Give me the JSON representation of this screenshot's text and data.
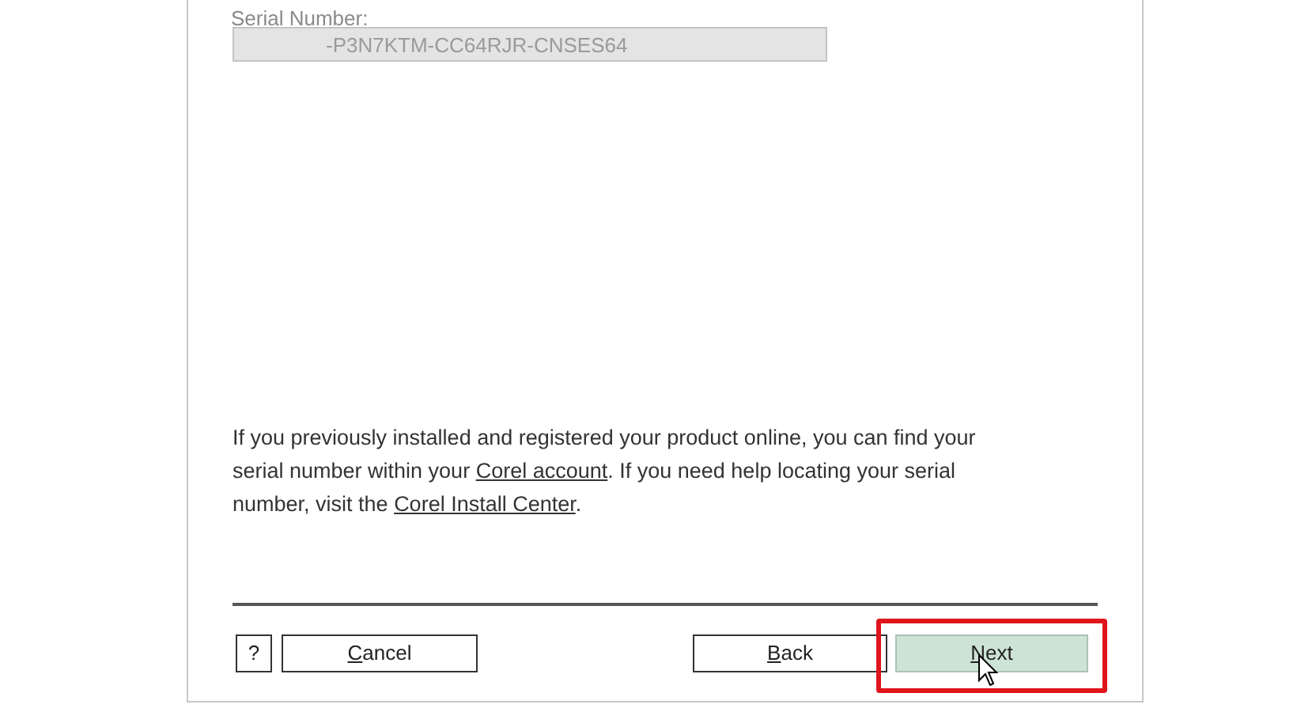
{
  "serial": {
    "label": "Serial Number:",
    "value": "-P3N7KTM-CC64RJR-CNSES64"
  },
  "help_text": [
    {
      "kind": "text",
      "text": "If you previously installed and registered your product online, you can find your serial number within your "
    },
    {
      "kind": "link",
      "text": "Corel account"
    },
    {
      "kind": "text",
      "text": ". If you need help locating your serial number, visit the "
    },
    {
      "kind": "link",
      "text": "Corel Install Center"
    },
    {
      "kind": "text",
      "text": "."
    }
  ],
  "buttons": [
    {
      "kind": "help",
      "label": "?",
      "mnemonic": false,
      "focused": false
    },
    {
      "kind": "cancel",
      "label": "Cancel",
      "mnemonic": true,
      "focused": false
    },
    {
      "kind": "back",
      "label": "Back",
      "mnemonic": true,
      "focused": false
    },
    {
      "kind": "next",
      "label": "Next",
      "mnemonic": true,
      "focused": true
    }
  ],
  "highlight_on_next": true
}
